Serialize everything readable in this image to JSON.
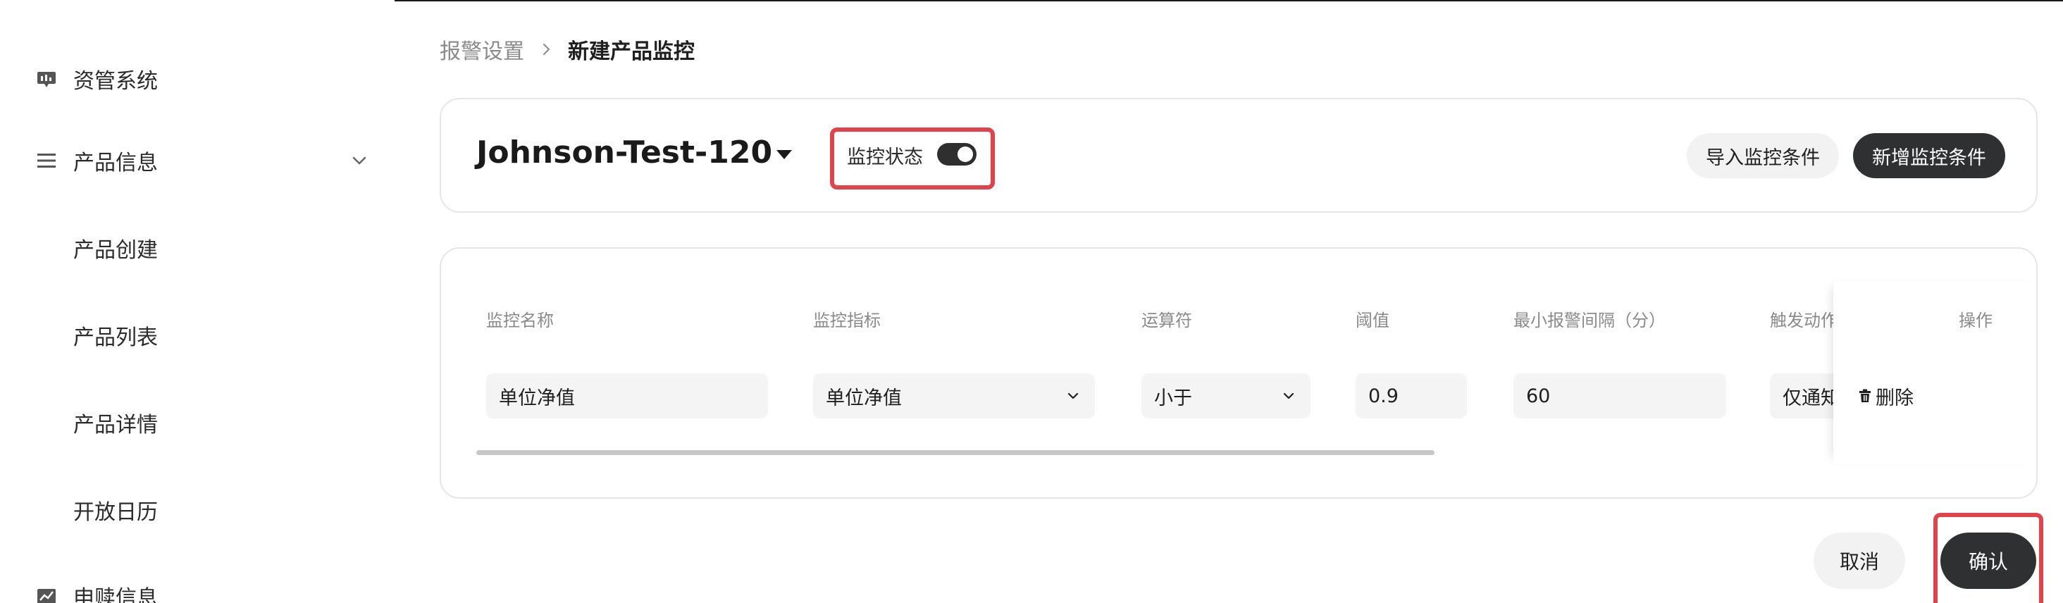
{
  "sidebar": {
    "items": [
      {
        "label": "资管系统",
        "icon": "dashboard-icon"
      },
      {
        "label": "产品信息",
        "icon": "menu-list-icon",
        "expanded": true
      },
      {
        "label": "产品创建"
      },
      {
        "label": "产品列表"
      },
      {
        "label": "产品详情"
      },
      {
        "label": "开放日历"
      },
      {
        "label": "申赎信息",
        "icon": "chart-icon"
      }
    ]
  },
  "breadcrumb": {
    "parent": "报警设置",
    "current": "新建产品监控"
  },
  "header": {
    "product_name": "Johnson-Test-120",
    "status_label": "监控状态",
    "status_on": true,
    "import_label": "导入监控条件",
    "add_label": "新增监控条件"
  },
  "table": {
    "columns": [
      "监控名称",
      "监控指标",
      "运算符",
      "阈值",
      "最小报警间隔（分）",
      "触发动作",
      "操作"
    ],
    "rows": [
      {
        "name": "单位净值",
        "metric": "单位净值",
        "operator": "小于",
        "threshold": "0.9",
        "interval": "60",
        "action": "仅通知",
        "delete_label": "删除"
      }
    ]
  },
  "footer": {
    "cancel_label": "取消",
    "confirm_label": "确认"
  },
  "colors": {
    "primary_dark": "#2f3032",
    "highlight_red": "#e0434a",
    "input_bg": "#f4f4f5",
    "muted_text": "#8a8a8a"
  }
}
